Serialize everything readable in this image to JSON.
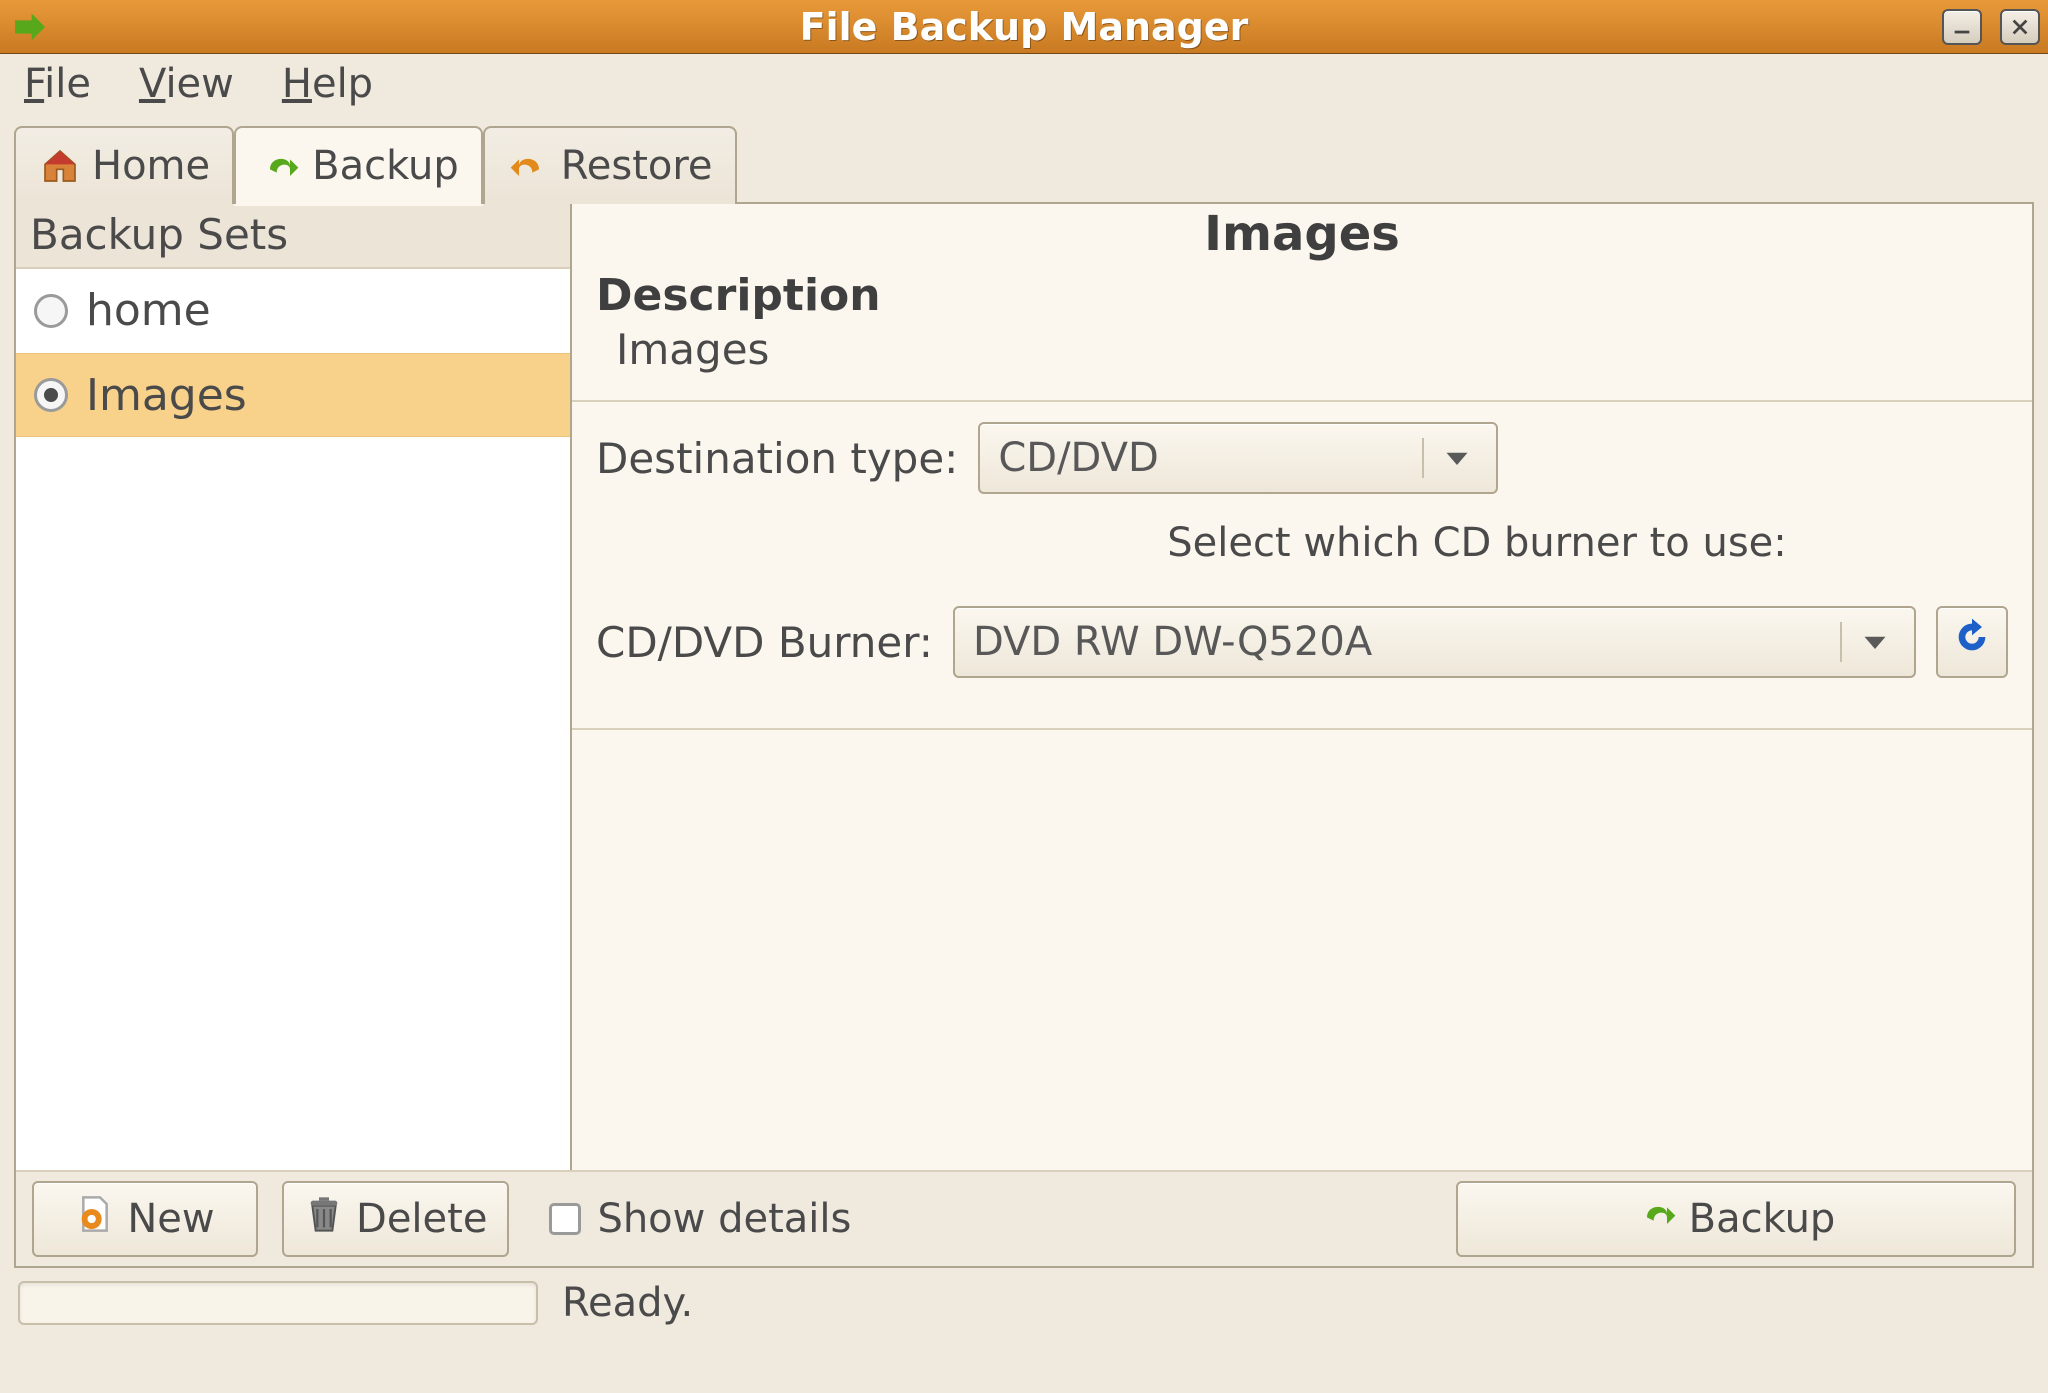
{
  "window": {
    "title": "File Backup Manager"
  },
  "menubar": {
    "file": "File",
    "view": "View",
    "help": "Help"
  },
  "tabs": {
    "home": "Home",
    "backup": "Backup",
    "restore": "Restore",
    "active": "backup"
  },
  "sidebar": {
    "header": "Backup Sets",
    "items": [
      {
        "label": "home",
        "selected": false
      },
      {
        "label": "Images",
        "selected": true
      }
    ]
  },
  "main": {
    "title": "Images",
    "description_label": "Description",
    "description_value": "Images",
    "dest_type_label": "Destination type:",
    "dest_type_value": "CD/DVD",
    "burner_hint": "Select which CD burner to use:",
    "burner_label": "CD/DVD Burner:",
    "burner_value": "DVD RW DW-Q520A"
  },
  "actions": {
    "new": "New",
    "delete": "Delete",
    "show_details": "Show details",
    "show_details_checked": false,
    "backup": "Backup"
  },
  "statusbar": {
    "text": "Ready."
  },
  "colors": {
    "titlebar": "#d78a2e",
    "selection": "#f8d18b",
    "green_arrow": "#58a81c",
    "orange_arrow": "#e28a1c",
    "refresh_blue": "#1c60c8"
  }
}
